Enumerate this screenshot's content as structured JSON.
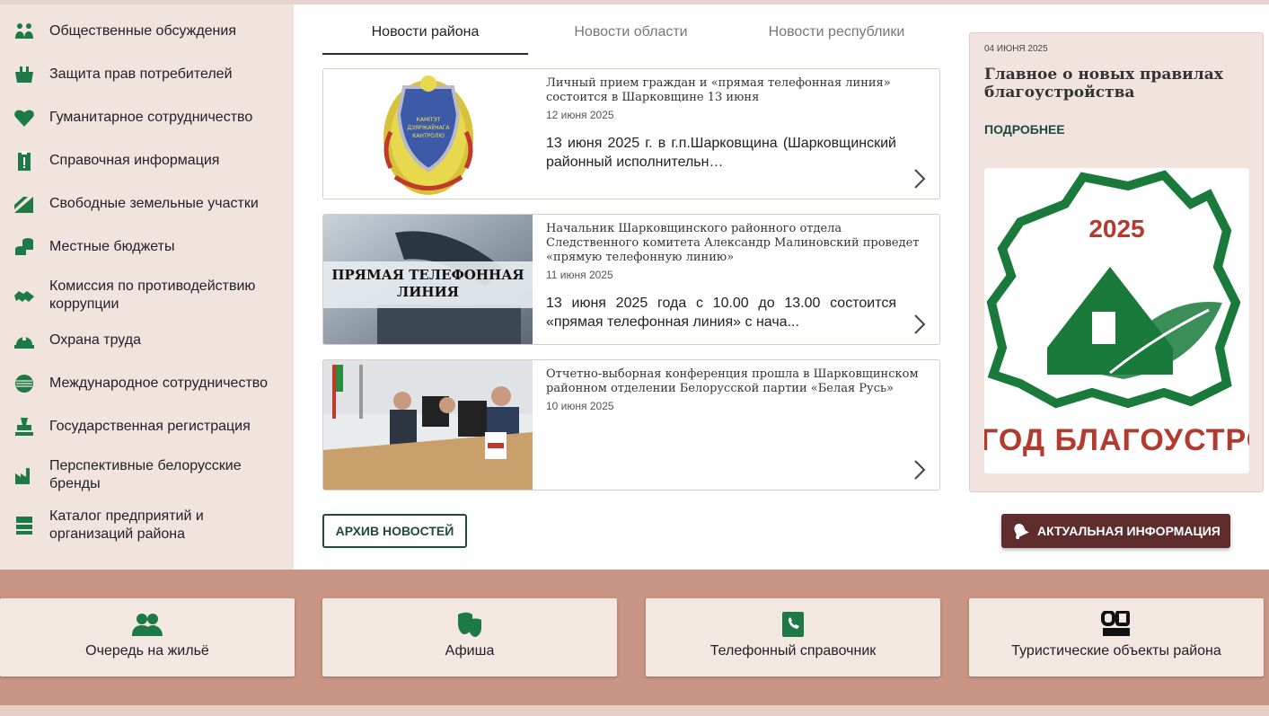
{
  "sidebar": {
    "items": [
      {
        "label": "Общественные обсуждения",
        "icon": "people-group-icon"
      },
      {
        "label": "Защита прав потребителей",
        "icon": "basket-icon"
      },
      {
        "label": "Гуманитарное сотрудничество",
        "icon": "heart-icon"
      },
      {
        "label": "Справочная информация",
        "icon": "info-clipboard-icon"
      },
      {
        "label": "Свободные земельные участки",
        "icon": "field-icon"
      },
      {
        "label": "Местные бюджеты",
        "icon": "coins-icon"
      },
      {
        "label": "Комиссия по противодействию коррупции",
        "icon": "handshake-icon"
      },
      {
        "label": "Охрана труда",
        "icon": "hard-hat-icon"
      },
      {
        "label": "Международное сотрудничество",
        "icon": "globe-icon"
      },
      {
        "label": "Государственная регистрация",
        "icon": "stamp-icon"
      },
      {
        "label": "Перспективные белорусские бренды",
        "icon": "factory-icon"
      },
      {
        "label": "Каталог предприятий и организаций района",
        "icon": "catalog-icon"
      }
    ]
  },
  "tabs": [
    {
      "label": "Новости района",
      "active": true
    },
    {
      "label": "Новости области",
      "active": false
    },
    {
      "label": "Новости республики",
      "active": false
    }
  ],
  "news": [
    {
      "title": "Личный прием граждан и «прямая телефонная линия» состоится в Шарковщине 13 июня",
      "date": "12 июня 2025",
      "excerpt": "13 июня 2025 г. в г.п.Шарковщина (Шарковщинский районный исполнительн…",
      "emblem_text": "КАМІТЭТ ДЗЯРЖАЎНАГА КАНТРОЛЮ"
    },
    {
      "title": "Начальник Шарковщинского районного отдела Следственного комитета Александр Малиновский проведет «прямую телефонную линию»",
      "date": "11 июня 2025",
      "excerpt": "13 июня 2025 года с 10.00 до 13.00 состоится «прямая телефонная линия» с нача...",
      "image_caption": "ПРЯМАЯ ТЕЛЕФОННАЯ ЛИНИЯ"
    },
    {
      "title": "Отчетно-выборная конференция прошла в Шарковщинском районном отделении Белорусской партии «Белая Русь»",
      "date": "10 июня 2025",
      "excerpt": ""
    }
  ],
  "archive_button": "АРХИВ НОВОСТЕЙ",
  "promo": {
    "date": "04 ИЮНЯ 2025",
    "title": "Главное о новых правилах благоустройства",
    "more": "ПОДРОБНЕЕ",
    "image_year": "2025",
    "image_caption": "ГОД БЛАГОУСТРОЙСТВА"
  },
  "actual_button": "АКТУАЛЬНАЯ ИНФОРМАЦИЯ",
  "tiles": [
    {
      "label": "Очередь на жильё",
      "icon": "people-icon"
    },
    {
      "label": "Афиша",
      "icon": "theater-masks-icon"
    },
    {
      "label": "Телефонный справочник",
      "icon": "phone-book-icon"
    },
    {
      "label": "Туристические объекты района",
      "icon": "qr-guide-icon"
    }
  ],
  "colors": {
    "accent_green": "#1e7a45",
    "dark_green": "#1f4a3c",
    "maroon": "#5e2c2c",
    "band": "#c99585",
    "sidebar_bg": "#f1e4df"
  }
}
